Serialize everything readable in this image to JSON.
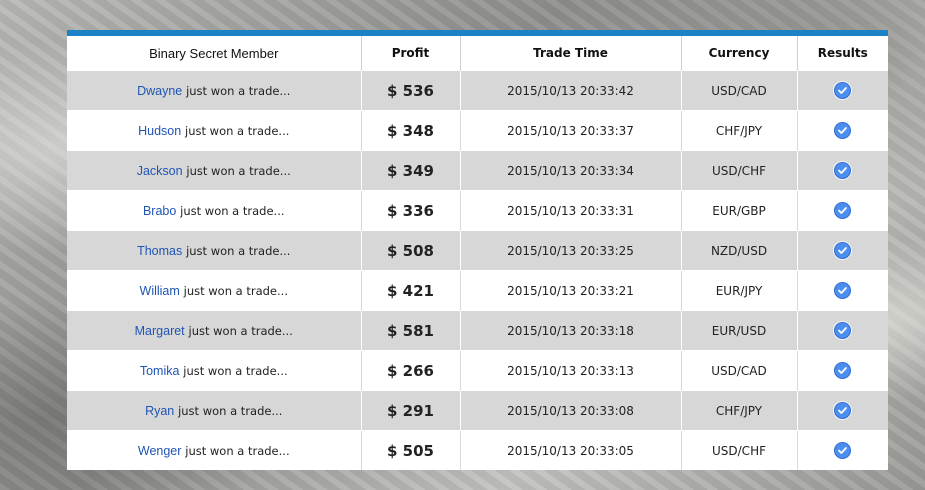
{
  "table": {
    "headers": {
      "member": "Binary Secret Member",
      "profit": "Profit",
      "time": "Trade Time",
      "currency": "Currency",
      "results": "Results"
    },
    "won_text": "just won a trade...",
    "rows": [
      {
        "name": "Dwayne",
        "profit": "$ 536",
        "time": "2015/10/13 20:33:42",
        "currency": "USD/CAD"
      },
      {
        "name": "Hudson",
        "profit": "$ 348",
        "time": "2015/10/13 20:33:37",
        "currency": "CHF/JPY"
      },
      {
        "name": "Jackson",
        "profit": "$ 349",
        "time": "2015/10/13 20:33:34",
        "currency": "USD/CHF"
      },
      {
        "name": "Brabo",
        "profit": "$ 336",
        "time": "2015/10/13 20:33:31",
        "currency": "EUR/GBP"
      },
      {
        "name": "Thomas",
        "profit": "$ 508",
        "time": "2015/10/13 20:33:25",
        "currency": "NZD/USD"
      },
      {
        "name": "William",
        "profit": "$ 421",
        "time": "2015/10/13 20:33:21",
        "currency": "EUR/JPY"
      },
      {
        "name": "Margaret",
        "profit": "$ 581",
        "time": "2015/10/13 20:33:18",
        "currency": "EUR/USD"
      },
      {
        "name": "Tomika",
        "profit": "$ 266",
        "time": "2015/10/13 20:33:13",
        "currency": "USD/CAD"
      },
      {
        "name": "Ryan",
        "profit": "$ 291",
        "time": "2015/10/13 20:33:08",
        "currency": "CHF/JPY"
      },
      {
        "name": "Wenger",
        "profit": "$ 505",
        "time": "2015/10/13 20:33:05",
        "currency": "USD/CHF"
      }
    ],
    "result_icon": "check-circle-icon",
    "colors": {
      "accent": "#1b82c6",
      "name": "#1f55b5",
      "check": "#4c8ef0",
      "row_alt": "#d7d7d7"
    }
  }
}
